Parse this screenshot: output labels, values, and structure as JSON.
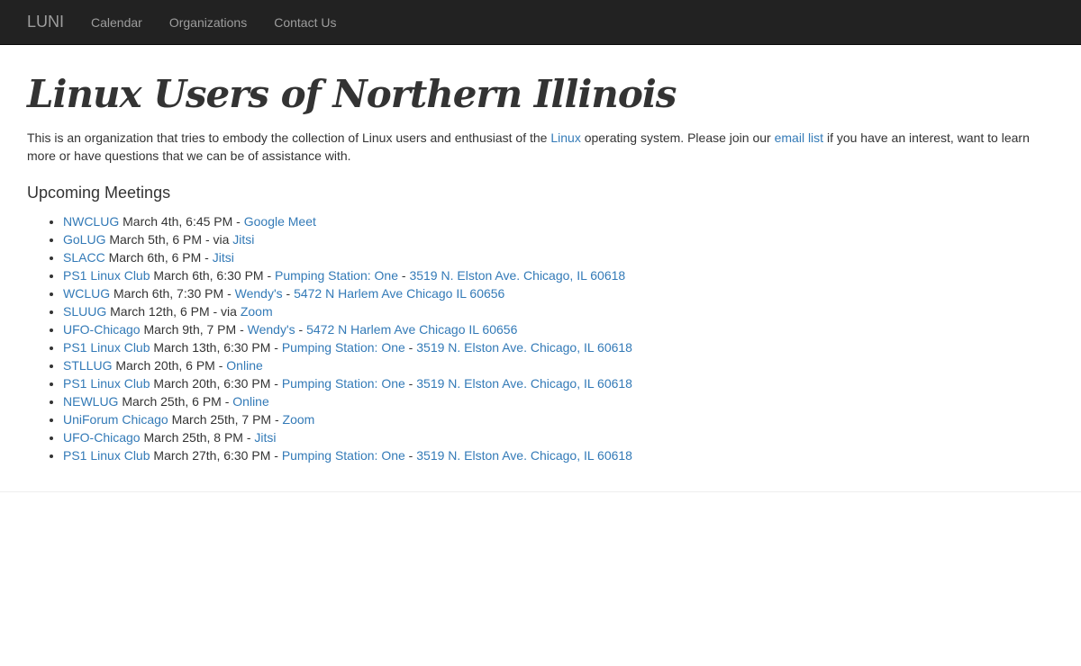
{
  "nav": {
    "brand": "LUNI",
    "links": [
      "Calendar",
      "Organizations",
      "Contact Us"
    ]
  },
  "page": {
    "title": "Linux Users of Northern Illinois",
    "intro": {
      "part1": "This is an organization that tries to embody the collection of Linux users and enthusiast of the ",
      "linux_link": "Linux",
      "part2": " operating system. Please join our ",
      "email_link": "email list",
      "part3": " if you have an interest, want to learn more or have questions that we can be of assistance with."
    },
    "meetings_heading": "Upcoming Meetings"
  },
  "meetings": [
    {
      "org": "NWCLUG",
      "when": " March 4th, 6:45 PM - ",
      "venue": "Google Meet"
    },
    {
      "org": "GoLUG",
      "when": " March 5th, 6 PM - via ",
      "venue": "Jitsi"
    },
    {
      "org": "SLACC",
      "when": " March 6th, 6 PM - ",
      "venue": "Jitsi"
    },
    {
      "org": "PS1 Linux Club",
      "when": " March 6th, 6:30 PM - ",
      "venue": "Pumping Station: One",
      "address": "3519 N. Elston Ave. Chicago, IL 60618"
    },
    {
      "org": "WCLUG",
      "when": " March 6th, 7:30 PM - ",
      "venue": "Wendy's",
      "address": "5472 N Harlem Ave Chicago IL 60656"
    },
    {
      "org": "SLUUG",
      "when": " March 12th, 6 PM - via ",
      "venue": "Zoom"
    },
    {
      "org": "UFO-Chicago",
      "when": " March 9th, 7 PM - ",
      "venue": "Wendy's",
      "address": "5472 N Harlem Ave Chicago IL 60656"
    },
    {
      "org": "PS1 Linux Club",
      "when": " March 13th, 6:30 PM - ",
      "venue": "Pumping Station: One",
      "address": "3519 N. Elston Ave. Chicago, IL 60618"
    },
    {
      "org": "STLLUG",
      "when": " March 20th, 6 PM - ",
      "venue": "Online"
    },
    {
      "org": "PS1 Linux Club",
      "when": " March 20th, 6:30 PM - ",
      "venue": "Pumping Station: One",
      "address": "3519 N. Elston Ave. Chicago, IL 60618"
    },
    {
      "org": "NEWLUG",
      "when": " March 25th, 6 PM - ",
      "venue": "Online"
    },
    {
      "org": "UniForum Chicago",
      "when": " March 25th, 7 PM - ",
      "venue": "Zoom"
    },
    {
      "org": "UFO-Chicago",
      "when": " March 25th, 8 PM - ",
      "venue": "Jitsi"
    },
    {
      "org": "PS1 Linux Club",
      "when": " March 27th, 6:30 PM - ",
      "venue": "Pumping Station: One",
      "address": "3519 N. Elston Ave. Chicago, IL 60618"
    }
  ],
  "separator": " - ",
  "colors": {
    "navbar_bg": "#222222",
    "link": "#337ab7",
    "text": "#333333"
  }
}
